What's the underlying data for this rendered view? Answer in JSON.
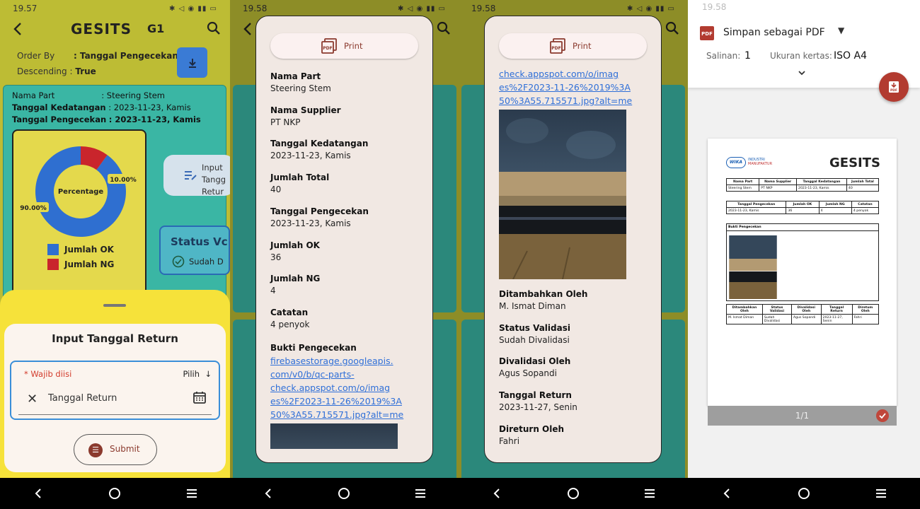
{
  "status_bar": {
    "time_1": "19.57",
    "time_2": "19.58",
    "time_3": "19.58",
    "time_4": "19.58",
    "battery": "80"
  },
  "app": {
    "logo": "GESITS",
    "group": "G1"
  },
  "order": {
    "order_by_label": "Order By",
    "order_by_value": ": Tanggal Pengecekan",
    "sort_label": "Descending :",
    "sort_value": "True"
  },
  "card": {
    "nama_part_label": "Nama Part",
    "nama_part_value": ": Steering Stem",
    "tgl_kedatangan_label": "Tanggal Kedatangan",
    "tgl_kedatangan_value": ": 2023-11-23, Kamis",
    "tgl_pengecekan_label": "Tanggal Pengecekan",
    "tgl_pengecekan_value": ": 2023-11-23, Kamis"
  },
  "chart_data": {
    "type": "pie",
    "center_label": "Percentage",
    "categories": [
      "Jumlah OK",
      "Jumlah NG"
    ],
    "values": [
      90.0,
      10.0
    ],
    "data_labels": [
      "90.00%",
      "10.00%"
    ],
    "colors": [
      "#2f6fd0",
      "#c9252c"
    ],
    "legend": [
      "Jumlah OK",
      "Jumlah NG"
    ]
  },
  "side_button": {
    "line1": "Input",
    "line2": "Tangg",
    "line3": "Retur"
  },
  "status_box": {
    "title": "Status Vc",
    "value": "Sudah D"
  },
  "sheet": {
    "title": "Input Tanggal Return",
    "required_label": "* Wajib diisi",
    "pilih": "Pilih",
    "field_value": "Tanggal Return",
    "submit_label": "Submit"
  },
  "dialog": {
    "print_label": "Print",
    "fields": [
      {
        "k": "Nama Part",
        "v": "Steering Stem"
      },
      {
        "k": "Nama Supplier",
        "v": "PT NKP"
      },
      {
        "k": "Tanggal Kedatangan",
        "v": "2023-11-23, Kamis"
      },
      {
        "k": "Jumlah Total",
        "v": "40"
      },
      {
        "k": "Tanggal Pengecekan",
        "v": "2023-11-23, Kamis"
      },
      {
        "k": "Jumlah OK",
        "v": "36"
      },
      {
        "k": "Jumlah NG",
        "v": "4"
      },
      {
        "k": "Catatan",
        "v": "4 penyok"
      }
    ],
    "bukti_label": "Bukti Pengecekan",
    "link_lines": [
      "firebasestorage.googleapis.",
      "com/v0/b/qc-parts-",
      "check.appspot.com/o/imag",
      "es%2F2023-11-26%2019%3A",
      "50%3A55.715571.jpg?alt=me"
    ],
    "fields_2": [
      {
        "k": "Ditambahkan Oleh",
        "v": "M. Ismat Diman"
      },
      {
        "k": "Status Validasi",
        "v": "Sudah Divalidasi"
      },
      {
        "k": "Divalidasi Oleh",
        "v": "Agus Sopandi"
      },
      {
        "k": "Tanggal Return",
        "v": "2023-11-27, Senin"
      },
      {
        "k": "Direturn Oleh",
        "v": "Fahri"
      }
    ]
  },
  "print_preview": {
    "destination": "Simpan sebagai PDF",
    "copies_label": "Salinan:",
    "copies_value": "1",
    "paper_label": "Ukuran kertas:",
    "paper_value": "ISO A4",
    "page_indicator": "1/1",
    "doc": {
      "brand_logo": "WIKA",
      "brand_line1": "INDUSTRI",
      "brand_line2": "MANUFAKTUR",
      "title": "GESITS",
      "t1_headers": [
        "Nama Part",
        "Nama Supplier",
        "Tanggal Kedatangan",
        "Jumlah Total"
      ],
      "t1_values": [
        "Steering Stem",
        "PT NKP",
        "2023-11-23, Kamis",
        "40"
      ],
      "t2_headers": [
        "Tanggal Pengecekan",
        "Jumlah OK",
        "Jumlah NG",
        "Catatan"
      ],
      "t2_values": [
        "2023-11-23, Kamis",
        "36",
        "4",
        "4 penyok"
      ],
      "bukti": "Bukti Pengecekan",
      "t3_headers": [
        "Ditambahkan Oleh",
        "Status Validasi",
        "Divalidasi Oleh",
        "Tanggal Return",
        "Diretum Oleh"
      ],
      "t3_values": [
        "M. Ismat Diman",
        "Sudah Divalidasi",
        "Agus Sopandi",
        "2023-11-27, Senin",
        "Fahri"
      ]
    }
  }
}
